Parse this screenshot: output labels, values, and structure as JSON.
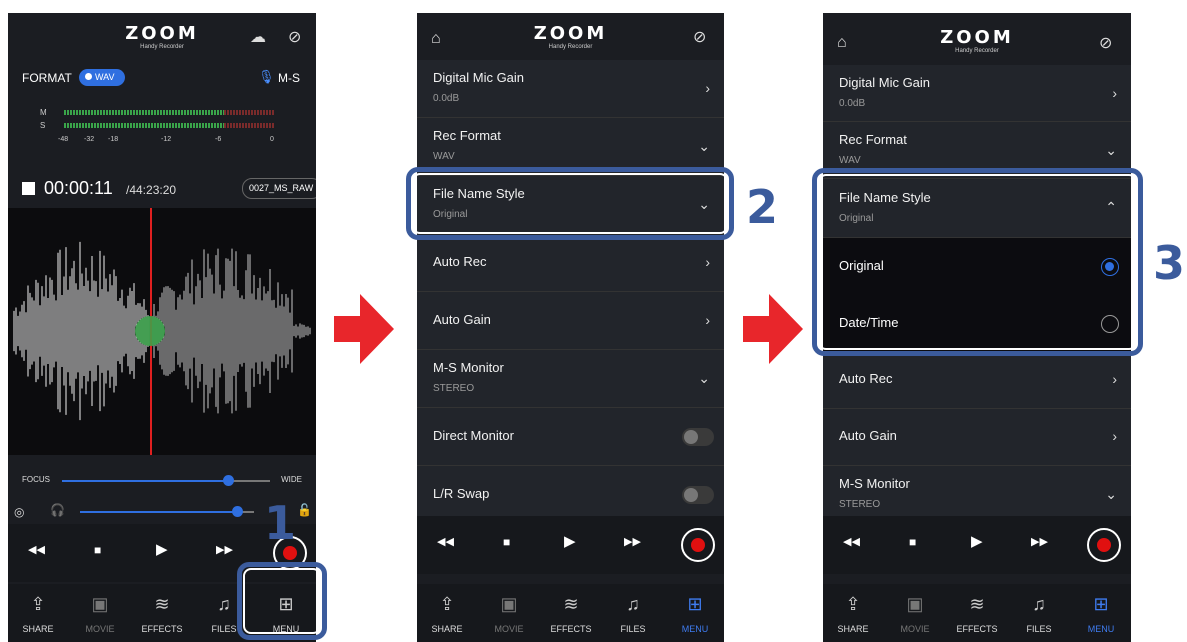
{
  "brand": {
    "logo": "ZOOM",
    "tagline": "Handy Recorder"
  },
  "screen1": {
    "format_label": "FORMAT",
    "format_value": "WAV",
    "mode": "M-S",
    "meter_channels": [
      "M",
      "S"
    ],
    "meter_scale": [
      "-48",
      "-32",
      "-18",
      "-12",
      "-6",
      "0"
    ],
    "elapsed": "00:00:11",
    "remaining": "/44:23:20",
    "filename": "0027_MS_RAW",
    "focus_label": "FOCUS",
    "wide_label": "WIDE",
    "focus_level": 0.8,
    "volume_level": 0.9
  },
  "transport": {
    "rewind": "◀◀",
    "stop": "■",
    "play": "▶",
    "ffwd": "▶▶"
  },
  "tabs": [
    "SHARE",
    "MOVIE",
    "EFFECTS",
    "FILES",
    "MENU"
  ],
  "screen2": {
    "items": [
      {
        "title": "Digital Mic Gain",
        "value": "0.0dB"
      },
      {
        "title": "Rec Format",
        "value": "WAV"
      },
      {
        "title": "File Name Style",
        "value": "Original"
      },
      {
        "title": "Auto Rec",
        "value": ""
      },
      {
        "title": "Auto Gain",
        "value": ""
      },
      {
        "title": "M-S Monitor",
        "value": "STEREO"
      },
      {
        "title": "Direct Monitor",
        "value": ""
      },
      {
        "title": "L/R Swap",
        "value": ""
      }
    ]
  },
  "screen3": {
    "items": [
      {
        "title": "Digital Mic Gain",
        "value": "0.0dB"
      },
      {
        "title": "Rec Format",
        "value": "WAV"
      },
      {
        "title": "File Name Style",
        "value": "Original"
      },
      {
        "title": "Auto Rec",
        "value": ""
      },
      {
        "title": "Auto Gain",
        "value": ""
      },
      {
        "title": "M-S Monitor",
        "value": "STEREO"
      }
    ],
    "options": [
      {
        "label": "Original",
        "selected": true
      },
      {
        "label": "Date/Time",
        "selected": false
      }
    ]
  },
  "steps": [
    "1",
    "2",
    "3"
  ],
  "colors": {
    "accent": "#2f6fe0",
    "highlight": "#3b5b9c",
    "arrow": "#e8262b",
    "record": "#e01010"
  }
}
